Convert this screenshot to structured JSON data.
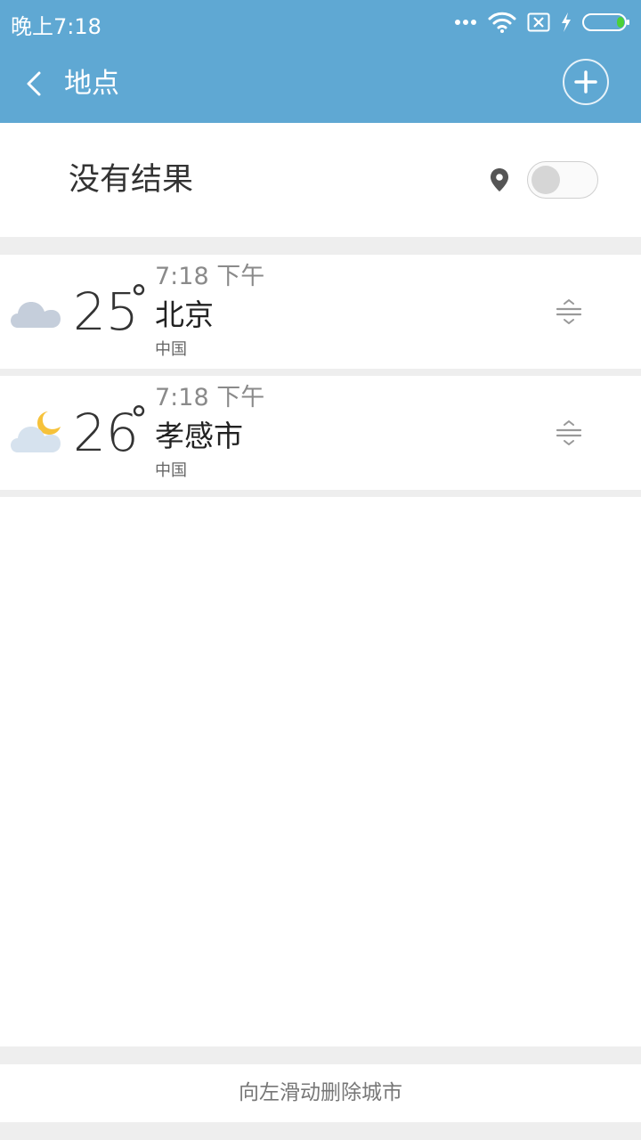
{
  "status_bar": {
    "time": "晚上7:18",
    "icons": [
      "more-dots-icon",
      "wifi-icon",
      "sim-x-icon",
      "charging-bolt-icon",
      "battery-icon"
    ],
    "battery_level": 0.1
  },
  "toolbar": {
    "title": "地点",
    "back_icon": "chevron-left-icon",
    "add_icon": "plus-icon"
  },
  "location": {
    "label": "没有结果",
    "icon": "location-pin-icon",
    "toggle_on": false
  },
  "cities": [
    {
      "temperature": "25",
      "degree_symbol": "°",
      "local_time": "7:18 下午",
      "name": "北京",
      "country": "中国",
      "weather_icon": "cloudy-icon"
    },
    {
      "temperature": "26",
      "degree_symbol": "°",
      "local_time": "7:18 下午",
      "name": "孝感市",
      "country": "中国",
      "weather_icon": "partly-cloudy-night-icon"
    }
  ],
  "footer": {
    "hint": "向左滑动删除城市"
  },
  "colors": {
    "header_bg": "#5fa8d3",
    "separator": "#eeeeee",
    "cloud_grey": "#c5cedb",
    "cloud_light": "#d6e2ee",
    "moon_yellow": "#f6c23b",
    "battery_green": "#4cd137"
  }
}
